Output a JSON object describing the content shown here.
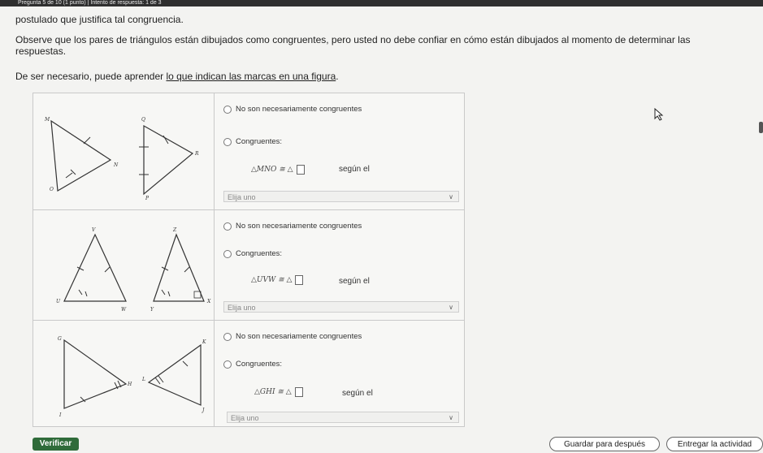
{
  "header": {
    "question_counter": "Pregunta 5 de 10 (1 punto) | Intento de respuesta: 1 de 3"
  },
  "instructions": {
    "postulate": "postulado que justifica tal congruencia.",
    "observe": "Observe que los pares de triángulos están dibujados como congruentes, pero usted no debe confiar en cómo están dibujados al momento de determinar las respuestas.",
    "learn_prefix": "De ser necesario, puede aprender ",
    "learn_link": "lo que indican las marcas en una figura",
    "learn_suffix": "."
  },
  "rows": [
    {
      "vertices": [
        "M",
        "Q",
        "N",
        "R",
        "O",
        "P"
      ],
      "option_not": "No son necesariamente congruentes",
      "option_cong": "Congruentes:",
      "equation": "△MNO ≅ △",
      "segun": "según el",
      "select_placeholder": "Elija uno",
      "chevron": "∨"
    },
    {
      "vertices": [
        "V",
        "Z",
        "U",
        "W",
        "Y",
        "X"
      ],
      "option_not": "No son necesariamente congruentes",
      "option_cong": "Congruentes:",
      "equation": "△UVW ≅ △",
      "segun": "según el",
      "select_placeholder": "Elija uno",
      "chevron": "∨"
    },
    {
      "vertices": [
        "G",
        "K",
        "H",
        "L",
        "I",
        "J"
      ],
      "option_not": "No son necesariamente congruentes",
      "option_cong": "Congruentes:",
      "equation": "△GHI ≅ △",
      "segun": "según el",
      "select_placeholder": "Elija uno",
      "chevron": "∨"
    }
  ],
  "footer": {
    "verify": "Verificar",
    "save_later": "Guardar para después",
    "submit": "Entregar la actividad"
  }
}
